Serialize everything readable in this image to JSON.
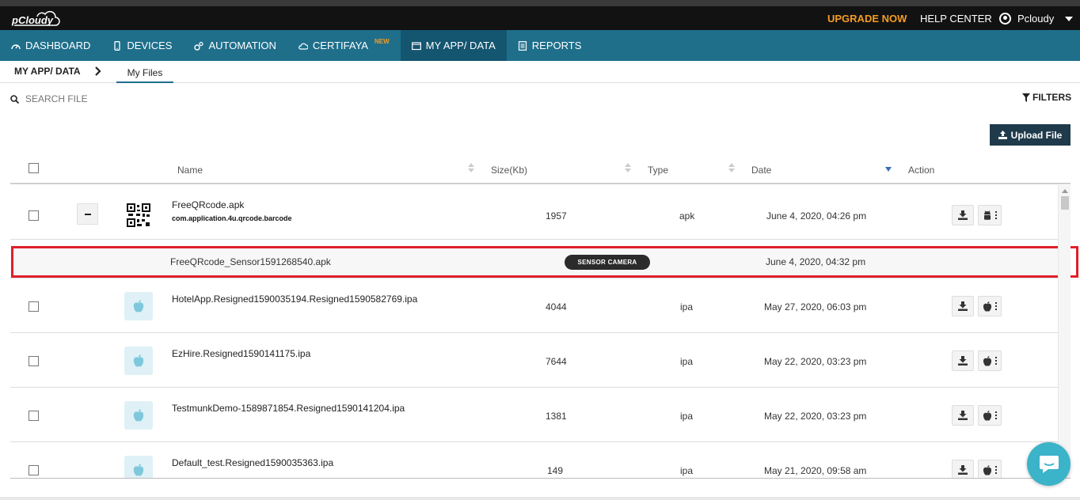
{
  "header": {
    "logo_text": "pCloudy",
    "upgrade_label": "UPGRADE NOW",
    "help_label": "HELP CENTER",
    "user_name": "Pcloudy"
  },
  "nav": {
    "items": [
      {
        "label": "DASHBOARD",
        "icon": "dashboard-icon"
      },
      {
        "label": "DEVICES",
        "icon": "mobile-icon"
      },
      {
        "label": "AUTOMATION",
        "icon": "gears-icon"
      },
      {
        "label": "CERTIFAYA",
        "icon": "cloud-icon",
        "badge": "NEW"
      },
      {
        "label": "MY APP/ DATA",
        "icon": "folder-icon",
        "active": true
      },
      {
        "label": "REPORTS",
        "icon": "document-icon"
      }
    ]
  },
  "breadcrumb": {
    "section": "MY APP/ DATA",
    "tab": "My Files"
  },
  "toolbar": {
    "search_placeholder": "SEARCH FILE",
    "filters_label": "FILTERS",
    "upload_label": "Upload File"
  },
  "table": {
    "columns": {
      "name": "Name",
      "size": "Size(Kb)",
      "type": "Type",
      "date": "Date",
      "action": "Action"
    },
    "rows": [
      {
        "name": "FreeQRcode.apk",
        "package": "com.application.4u.qrcode.barcode",
        "size": "1957",
        "type": "apk",
        "date": "June 4, 2020, 04:26 pm"
      },
      {
        "name": "HotelApp.Resigned1590035194.Resigned1590582769.ipa",
        "size": "4044",
        "type": "ipa",
        "date": "May 27, 2020, 06:03 pm"
      },
      {
        "name": "EzHire.Resigned1590141175.ipa",
        "size": "7644",
        "type": "ipa",
        "date": "May 22, 2020, 03:23 pm"
      },
      {
        "name": "TestmunkDemo-1589871854.Resigned1590141204.ipa",
        "size": "1381",
        "type": "ipa",
        "date": "May 22, 2020, 03:23 pm"
      },
      {
        "name": "Default_test.Resigned1590035363.ipa",
        "size": "149",
        "type": "ipa",
        "date": "May 21, 2020, 09:58 am"
      }
    ],
    "subrow": {
      "name": "FreeQRcode_Sensor1591268540.apk",
      "badge": "SENSOR CAMERA",
      "date": "June 4, 2020, 04:32 pm"
    }
  },
  "colors": {
    "nav_bg": "#1f6f8b",
    "nav_active": "#145570",
    "upgrade": "#f39c25",
    "highlight": "#e0202a",
    "upload_bg": "#1f3a4b",
    "chat": "#3bb3c9"
  }
}
